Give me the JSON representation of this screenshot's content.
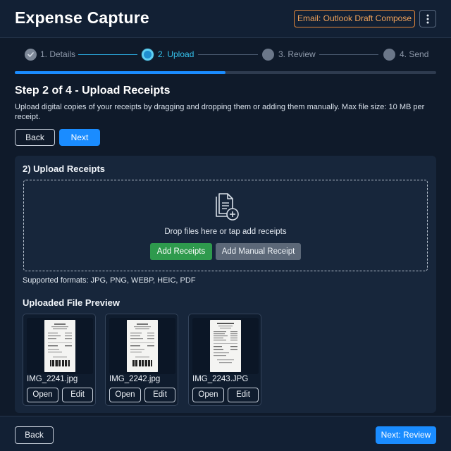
{
  "app": {
    "title": "Expense Capture",
    "email_button": "Email: Outlook Draft Compose",
    "menu_icon": "vertical-ellipsis-icon"
  },
  "stepper": {
    "steps": [
      {
        "label": "1. Details",
        "state": "done"
      },
      {
        "label": "2. Upload",
        "state": "active"
      },
      {
        "label": "3. Review",
        "state": "pending"
      },
      {
        "label": "4. Send",
        "state": "pending"
      }
    ],
    "progress_percent": 50
  },
  "intro": {
    "title": "Step 2 of 4 - Upload Receipts",
    "description": "Upload digital copies of your receipts by dragging and dropping them or adding them manually. Max file size: 10 MB per receipt.",
    "back_label": "Back",
    "next_label": "Next"
  },
  "upload": {
    "title": "2) Upload Receipts",
    "icon": "document-add-icon",
    "drop_text": "Drop files here or tap add receipts",
    "add_receipts_label": "Add Receipts",
    "add_manual_label": "Add Manual Receipt",
    "formats": "Supported formats: JPG, PNG, WEBP, HEIC, PDF"
  },
  "preview": {
    "title": "Uploaded File Preview",
    "files": [
      {
        "name": "IMG_2241.jpg",
        "open_label": "Open",
        "edit_label": "Edit"
      },
      {
        "name": "IMG_2242.jpg",
        "open_label": "Open",
        "edit_label": "Edit"
      },
      {
        "name": "IMG_2243.JPG",
        "open_label": "Open",
        "edit_label": "Edit"
      }
    ]
  },
  "footer": {
    "back_label": "Back",
    "next_label": "Next: Review"
  },
  "colors": {
    "background": "#0f1a2a",
    "accent": "#1a8cff",
    "active_step": "#35c0ea",
    "email_outline": "#e0853a",
    "add_receipts": "#2e9a4d"
  }
}
